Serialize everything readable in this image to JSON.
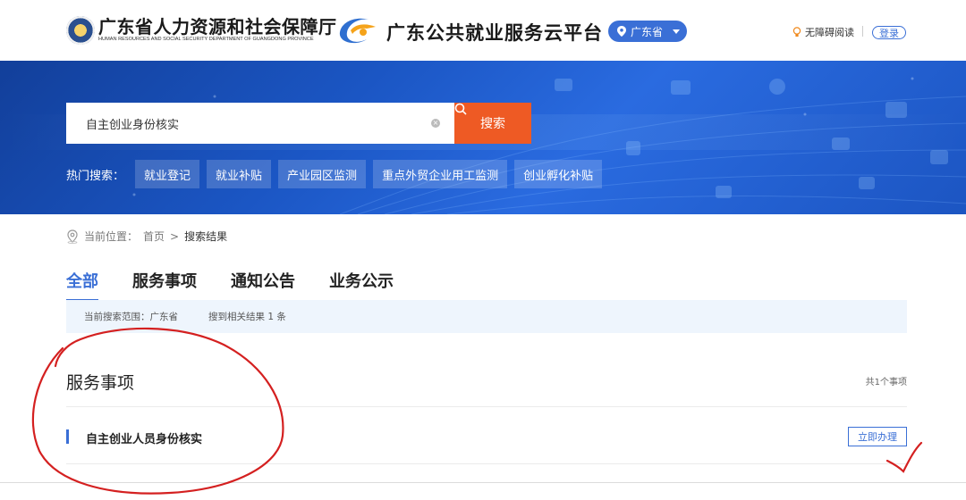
{
  "header": {
    "department_cn": "广东省人力资源和社会保障厅",
    "department_en": "HUMAN RESOURCES AND SOCIAL SECURITY DEPARTMENT OF GUANGDONG PROVINCE",
    "platform_title": "广东公共就业服务云平台",
    "region": "广东省",
    "accessibility": "无障碍阅读",
    "login": "登录"
  },
  "search": {
    "value": "自主创业身份核实",
    "button_label": "搜索",
    "hot_label": "热门搜索：",
    "hot_tags": [
      "就业登记",
      "就业补贴",
      "产业园区监测",
      "重点外贸企业用工监测",
      "创业孵化补贴"
    ]
  },
  "breadcrumb": {
    "prefix": "当前位置：",
    "home": "首页",
    "separator": ">",
    "current": "搜索结果"
  },
  "tabs": [
    "全部",
    "服务事项",
    "通知公告",
    "业务公示"
  ],
  "scope": {
    "range": "当前搜索范围：广东省",
    "result": "搜到相关结果 1 条"
  },
  "section": {
    "title": "服务事项",
    "count": "共1个事项",
    "items": [
      {
        "title": "自主创业人员身份核实",
        "action": "立即办理"
      }
    ]
  },
  "colors": {
    "primary": "#3a6fd6",
    "search_button": "#ee5a24",
    "annotation": "#d42020"
  }
}
